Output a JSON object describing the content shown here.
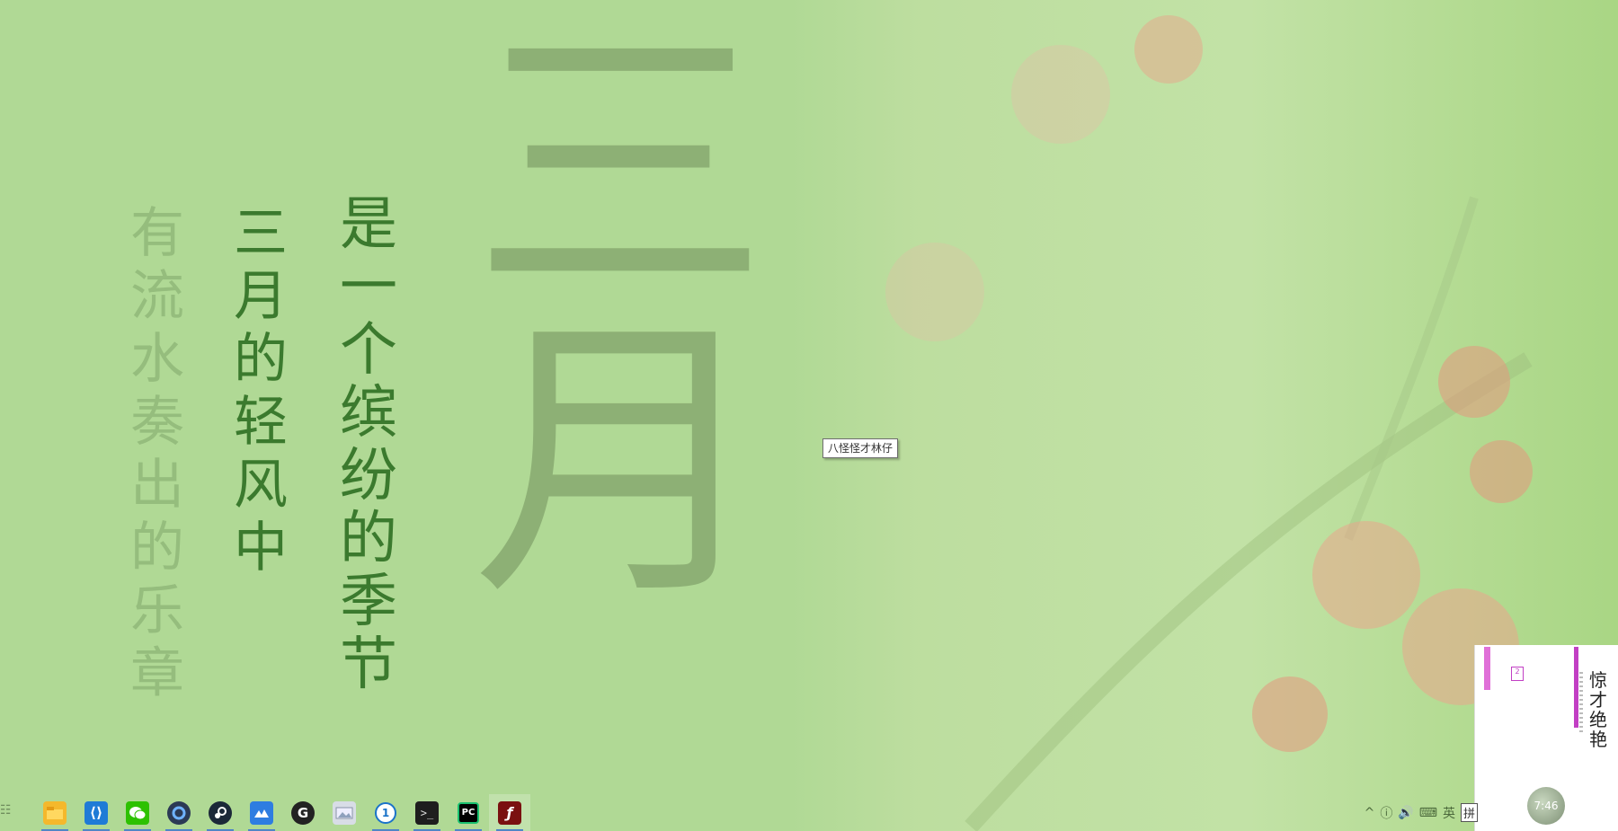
{
  "wallpaper": {
    "big_chars": [
      "三",
      "月"
    ],
    "column1": [
      "是",
      "一",
      "个",
      "缤",
      "纷",
      "的",
      "季",
      "节"
    ],
    "column2": [
      "三",
      "月",
      "的",
      "轻",
      "风",
      "中"
    ],
    "column3": [
      "有",
      "流",
      "水",
      "奏",
      "出",
      "的",
      "乐",
      "章"
    ]
  },
  "tooltip": "八怪怪才林仔",
  "taskbar": {
    "apps": [
      {
        "name": "file-explorer-icon",
        "label": "File Explorer",
        "color": "#f4b82c"
      },
      {
        "name": "vscode-icon",
        "label": "Visual Studio Code",
        "color": "#1f7bd6"
      },
      {
        "name": "wechat-icon",
        "label": "WeChat",
        "color": "#2dc100"
      },
      {
        "name": "app-ring-icon",
        "label": "App",
        "color": "#2b3a55"
      },
      {
        "name": "steam-icon",
        "label": "Steam",
        "color": "#1b2838"
      },
      {
        "name": "cloud-app-icon",
        "label": "Cloud App",
        "color": "#2e7de1"
      },
      {
        "name": "g-app-icon",
        "label": "G App",
        "color": "#222222"
      },
      {
        "name": "image-viewer-icon",
        "label": "Image Viewer",
        "color": "#d8dde6"
      },
      {
        "name": "password-manager-icon",
        "label": "Password Manager",
        "color": "#1a73c9"
      },
      {
        "name": "terminal-icon",
        "label": "Terminal",
        "color": "#1e1e1e"
      },
      {
        "name": "pycharm-icon",
        "label": "PyCharm",
        "color": "#19c06f"
      },
      {
        "name": "flash-icon",
        "label": "Flash",
        "color": "#7a1010"
      }
    ],
    "tray": {
      "chevron": "^",
      "volume": "🔊",
      "keyboard": "⌨",
      "lang": "英",
      "ime": "拼"
    }
  },
  "widget": {
    "title": [
      "惊",
      "才",
      "绝",
      "艳"
    ],
    "badge": "2",
    "clock": "7:46"
  }
}
